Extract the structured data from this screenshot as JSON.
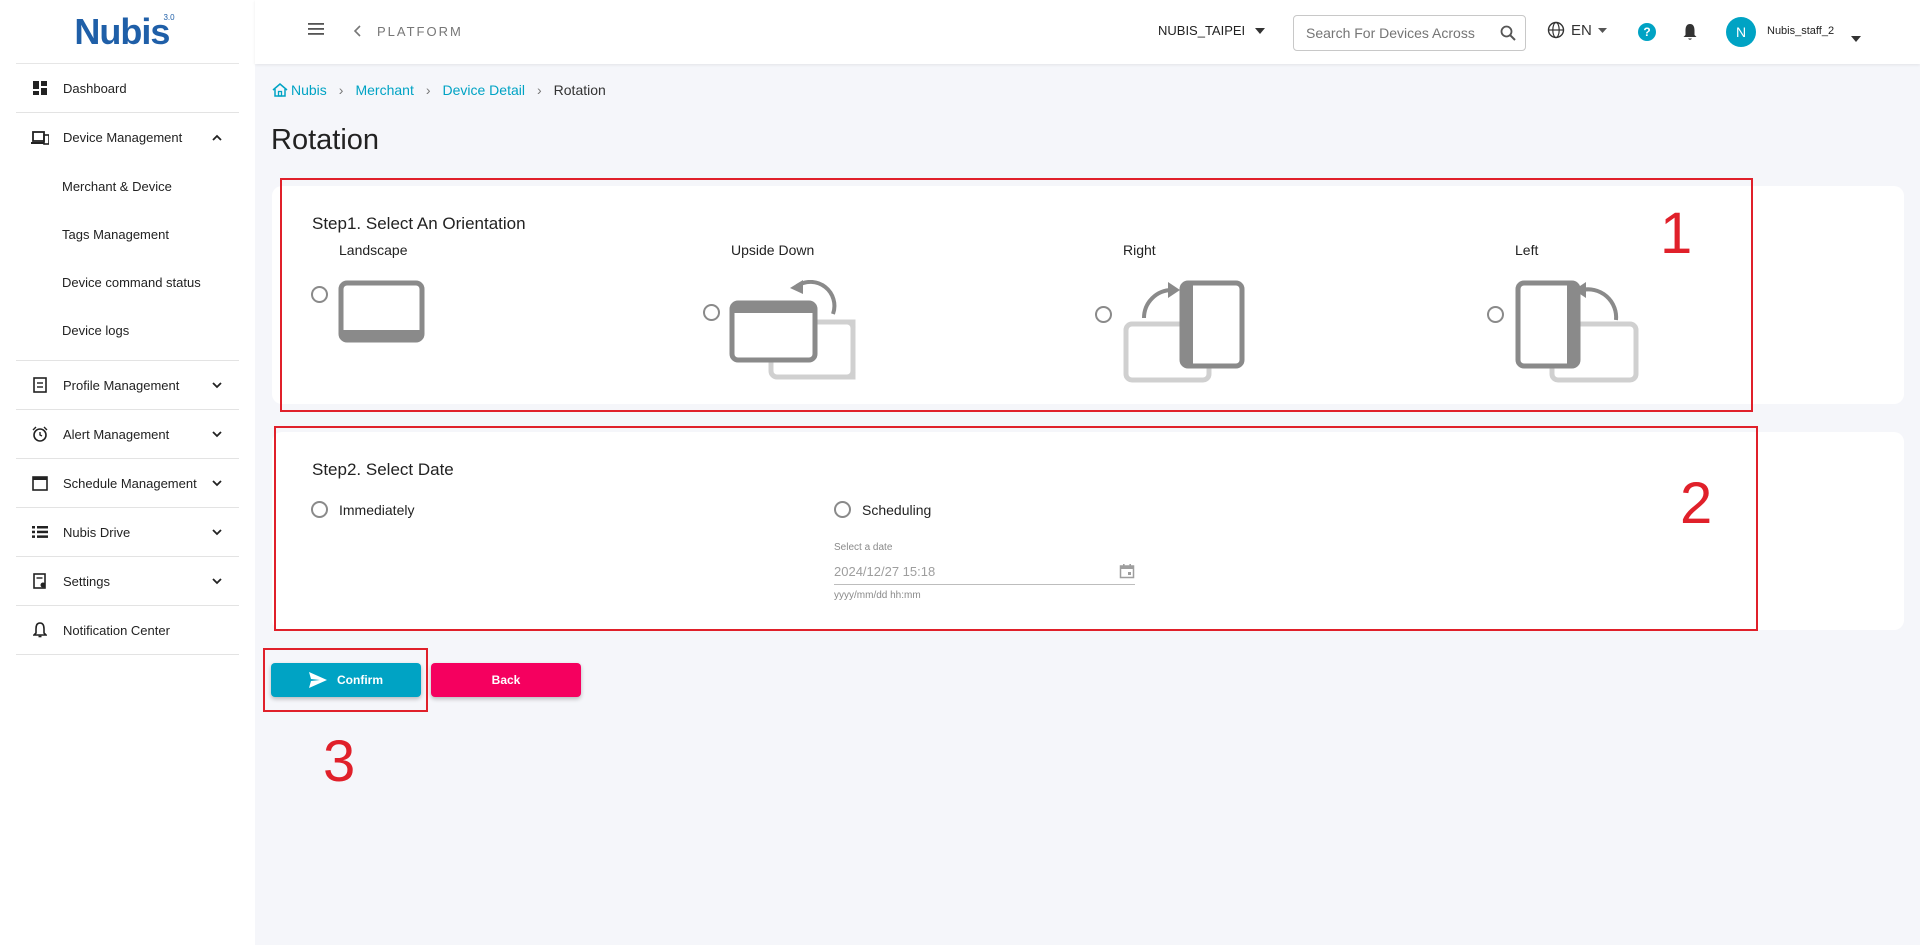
{
  "app": {
    "logo": "Nubis",
    "logo_sup": "3.0"
  },
  "sidebar": {
    "items": [
      {
        "label": "Dashboard",
        "icon": "dashboard-icon"
      },
      {
        "label": "Device Management",
        "icon": "devices-icon",
        "expanded": true,
        "children": [
          "Merchant & Device",
          "Tags Management",
          "Device command status",
          "Device logs"
        ]
      },
      {
        "label": "Profile Management",
        "icon": "profile-icon"
      },
      {
        "label": "Alert Management",
        "icon": "alarm-icon"
      },
      {
        "label": "Schedule Management",
        "icon": "calendar-icon"
      },
      {
        "label": "Nubis Drive",
        "icon": "list-icon"
      },
      {
        "label": "Settings",
        "icon": "settings-icon"
      },
      {
        "label": "Notification Center",
        "icon": "bell-icon"
      }
    ]
  },
  "topbar": {
    "platform": "PLATFORM",
    "merchant": "NUBIS_TAIPEI",
    "search_placeholder": "Search For Devices Across",
    "lang": "EN",
    "help": "?",
    "avatar": "N",
    "username": "Nubis_staff_2"
  },
  "breadcrumb": {
    "home": "Nubis",
    "merchant": "Merchant",
    "detail": "Device Detail",
    "current": "Rotation"
  },
  "page": {
    "title": "Rotation"
  },
  "step1": {
    "title": "Step1. Select An Orientation",
    "options": [
      "Landscape",
      "Upside Down",
      "Right",
      "Left"
    ]
  },
  "step2": {
    "title": "Step2. Select Date",
    "options": [
      "Immediately",
      "Scheduling"
    ],
    "date_label": "Select a date",
    "date_value": "2024/12/27 15:18",
    "date_hint": "yyyy/mm/dd hh:mm"
  },
  "actions": {
    "confirm": "Confirm",
    "back": "Back"
  },
  "annotations": [
    "1",
    "2",
    "3"
  ],
  "colors": {
    "accent": "#00a3c4",
    "danger": "#f5005f",
    "annotation": "#e0202a"
  }
}
